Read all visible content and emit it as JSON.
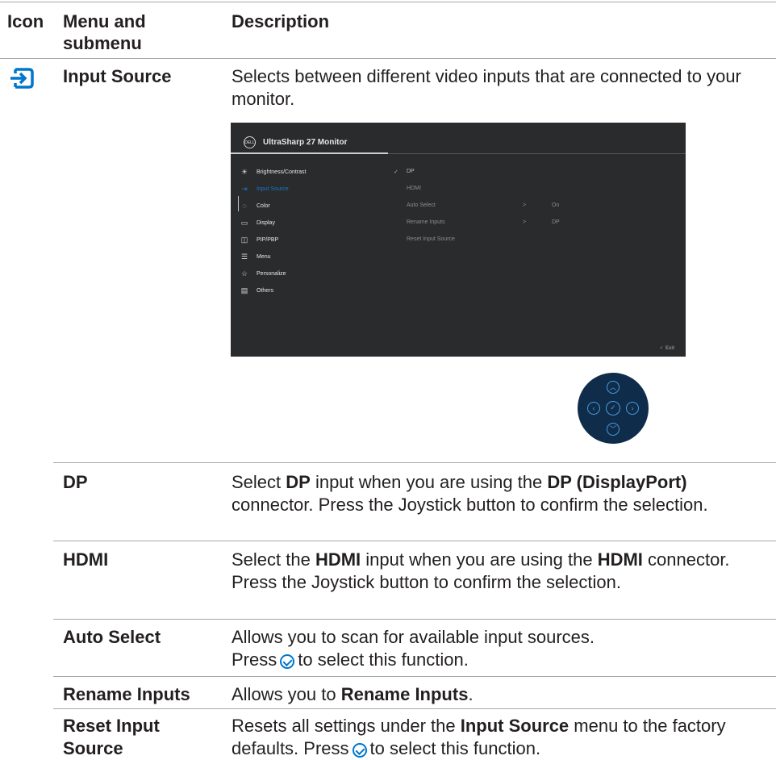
{
  "header": {
    "icon_col": "Icon",
    "menu_col": "Menu and submenu",
    "desc_col": "Description"
  },
  "input_source": {
    "icon": "input-source-icon",
    "label": "Input Source",
    "description": "Selects between different video inputs that are connected to your monitor."
  },
  "osd": {
    "logo": "DELL",
    "title": "UltraSharp 27 Monitor",
    "menu_items": [
      {
        "label": "Brightness/Contrast",
        "icon": "brightness-icon"
      },
      {
        "label": "Input Source",
        "icon": "input-source-icon"
      },
      {
        "label": "Color",
        "icon": "color-icon"
      },
      {
        "label": "Display",
        "icon": "display-icon"
      },
      {
        "label": "PIP/PBP",
        "icon": "pip-icon"
      },
      {
        "label": "Menu",
        "icon": "menu-icon"
      },
      {
        "label": "Personalize",
        "icon": "star-icon"
      },
      {
        "label": "Others",
        "icon": "others-icon"
      }
    ],
    "selected_menu": "Input Source",
    "submenu": [
      {
        "label": "DP",
        "value": "",
        "checked": true
      },
      {
        "label": "HDMI",
        "value": ""
      },
      {
        "label": "Auto Select",
        "value": "On"
      },
      {
        "label": "Rename Inputs",
        "value": "DP"
      },
      {
        "label": "Reset Input Source",
        "value": ""
      }
    ],
    "arrow": ">",
    "exit": "Exit"
  },
  "rows": {
    "dp": {
      "label": "DP",
      "t1": "Select ",
      "b1": "DP",
      "t2": " input when you are using the ",
      "b2": "DP (DisplayPort)",
      "t3": " connector. Press the Joystick button to confirm the selection."
    },
    "hdmi": {
      "label": "HDMI",
      "t1": "Select the ",
      "b1": "HDMI",
      "t2": " input when you are using the ",
      "b2": "HDMI",
      "t3": " connector. Press the Joystick button to confirm the selection."
    },
    "auto": {
      "label": "Auto Select",
      "line1": "Allows you to scan for available input sources.",
      "press": "Press",
      "after": "to select this function."
    },
    "rename": {
      "label": "Rename Inputs",
      "t1": "Allows you to ",
      "b1": "Rename Inputs",
      "t2": "."
    },
    "reset": {
      "label": "Reset Input Source",
      "t1": "Resets all settings under the ",
      "b1": "Input Source",
      "t2": " menu to the factory defaults. Press",
      "after": "to select this function."
    }
  }
}
